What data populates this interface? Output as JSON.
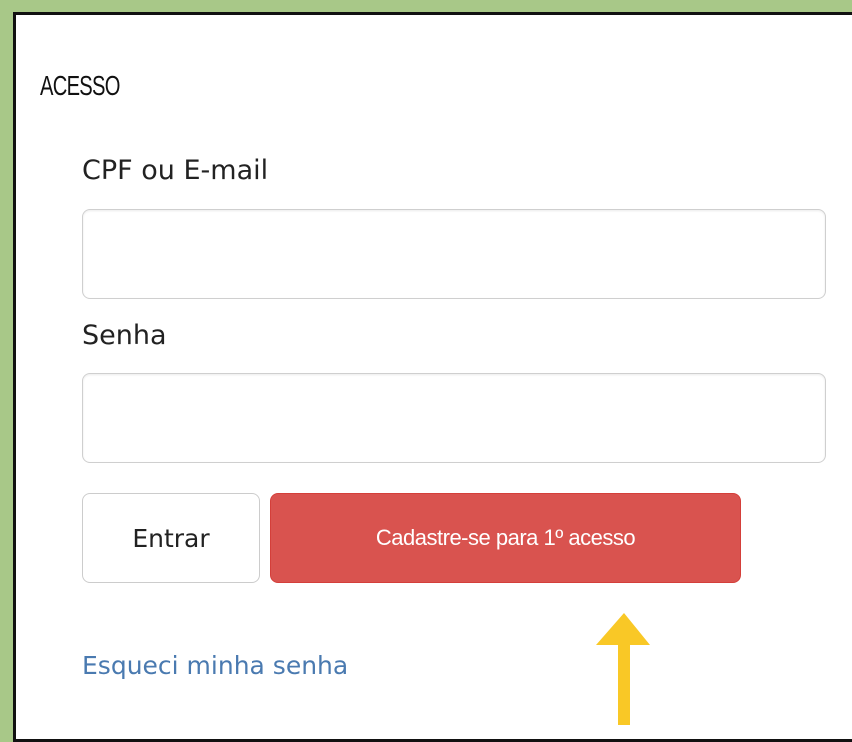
{
  "section": {
    "title": "ACESSO"
  },
  "form": {
    "cpf_label": "CPF ou E-mail",
    "cpf_value": "",
    "senha_label": "Senha",
    "senha_value": "",
    "entrar_label": "Entrar",
    "cadastro_label": "Cadastre-se para 1º acesso",
    "forgot_link": "Esqueci minha senha"
  },
  "annotation": {
    "arrow_icon": "up-arrow-icon",
    "arrow_color": "#f9c826"
  },
  "colors": {
    "background": "#a8c888",
    "primary_button": "#d9534f",
    "link": "#4a7ab0"
  }
}
